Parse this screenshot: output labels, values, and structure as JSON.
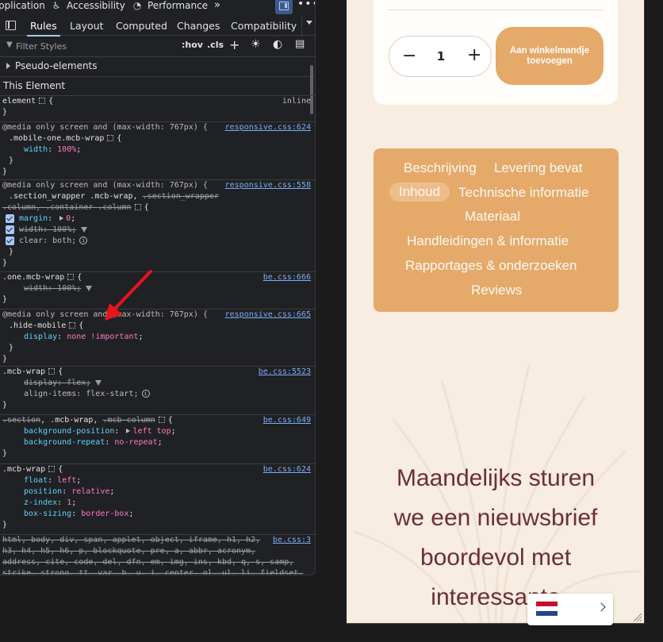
{
  "devtools": {
    "top_tabs": [
      "pplication",
      "Accessibility",
      "Performance"
    ],
    "sub_tabs": [
      "Rules",
      "Layout",
      "Computed",
      "Changes",
      "Compatibility"
    ],
    "active_sub_tab": "Rules",
    "filter_placeholder": "Filter Styles",
    "hov_label": ":hov",
    "cls_label": ".cls",
    "pseudo_elements_label": "Pseudo-elements",
    "this_element_label": "This Element",
    "rules": {
      "r0": {
        "selector": "element",
        "brace": "{",
        "source": "inline",
        "close": "}"
      },
      "r1": {
        "media": "@media only screen and (max-width: 767px) {",
        "selector": ".mobile-one.mcb-wrap",
        "source": "responsive.css:624",
        "p1_name": "width",
        "p1_value": "100%"
      },
      "r2": {
        "media": "@media only screen and (max-width: 767px) {",
        "selector_a": ".section_wrapper .mcb-wrap, ",
        "selector_b": ".section_wrapper",
        "selector_c": ".column, ",
        "selector_d": ".container .column",
        "source": "responsive.css:558",
        "p1_name": "margin",
        "p1_value": "0",
        "p2": "width: 100%;",
        "p3": "clear: both;"
      },
      "r3": {
        "selector": ".one.mcb-wrap",
        "source": "be.css:666",
        "p1": "width: 100%;"
      },
      "r4": {
        "media": "@media only screen and (max-width: 767px) {",
        "selector": ".hide-mobile",
        "source": "responsive.css:665",
        "p1_name": "display",
        "p1_value": "none !important"
      },
      "r5": {
        "selector": ".mcb-wrap",
        "source": "be.css:5523",
        "p1": "display: flex;",
        "p2": "align-items: flex-start;"
      },
      "r6": {
        "selector_a": ".section",
        "selector_b": ", .mcb-wrap, ",
        "selector_c": ".mcb-column",
        "source": "be.css:649",
        "p1_name": "background-position",
        "p1_value": "left top",
        "p2_name": "background-repeat",
        "p2_value": "no-repeat"
      },
      "r7": {
        "selector": ".mcb-wrap",
        "source": "be.css:624",
        "p1_name": "float",
        "p1_value": "left",
        "p2_name": "position",
        "p2_value": "relative",
        "p3_name": "z-index",
        "p3_value": "1",
        "p4_name": "box-sizing",
        "p4_value": "border-box"
      },
      "r8": {
        "source": "be.css:3",
        "line1": "html, body, div, span, applet, object, iframe, h1, h2,",
        "line2": "h3, h4, h5, h6, p, blockquote, pre, a, abbr, acronym,",
        "line3": "address, cite, code, del, dfn, em, img, ins, kbd, q, s, samp,",
        "line4": "strike, strong, tt, var, b, u, i, center, ol, ul, li, fieldset,"
      }
    }
  },
  "site": {
    "qty_minus": "−",
    "qty_value": "1",
    "qty_plus": "+",
    "add_to_cart": "Aan winkelmandje toevoegen",
    "tabs": [
      "Beschrijving",
      "Levering bevat",
      "Inhoud",
      "Technische informatie",
      "Materiaal",
      "Handleidingen & informatie",
      "Rapportages & onderzoeken",
      "Reviews"
    ],
    "active_tab": "Inhoud",
    "newsletter_lines": [
      "Maandelijks sturen",
      "we een nieuwsbrief",
      "boordevol met",
      "interessante"
    ]
  },
  "colors": {
    "accent": "#e5a96a",
    "heading": "#6b2f36",
    "site_bg": "#f7ede0",
    "devtools_bg": "#202124",
    "link": "#7cacf8",
    "annotation_arrow": "#e8141c"
  }
}
